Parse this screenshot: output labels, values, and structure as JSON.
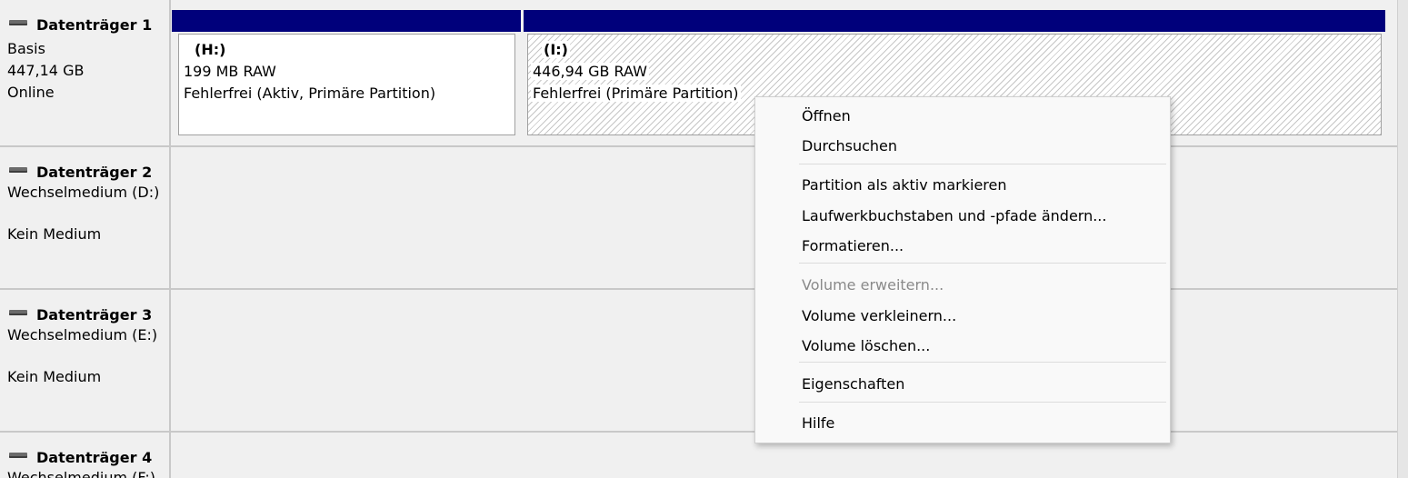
{
  "disks": [
    {
      "title": "Datenträger 1",
      "lines": [
        "Basis",
        "447,14 GB",
        "Online"
      ],
      "partitions": [
        {
          "title": "(H:)",
          "size": "199 MB RAW",
          "status": "Fehlerfrei (Aktiv, Primäre Partition)"
        },
        {
          "title": "(I:)",
          "size": "446,94 GB RAW",
          "status": "Fehlerfrei (Primäre Partition)"
        }
      ]
    },
    {
      "title": "Datenträger 2",
      "line1": "Wechselmedium (D:)",
      "line2": "Kein Medium"
    },
    {
      "title": "Datenträger 3",
      "line1": "Wechselmedium (E:)",
      "line2": "Kein Medium"
    },
    {
      "title": "Datenträger 4",
      "line1": "Wechselmedium (F:)"
    }
  ],
  "context_menu": {
    "open": "Öffnen",
    "explore": "Durchsuchen",
    "mark_active": "Partition als aktiv markieren",
    "change_letter": "Laufwerkbuchstaben und -pfade ändern...",
    "format": "Formatieren...",
    "extend": "Volume erweitern...",
    "shrink": "Volume verkleinern...",
    "delete": "Volume löschen...",
    "properties": "Eigenschaften",
    "help": "Hilfe"
  },
  "colors": {
    "partition_bar": "#00007b",
    "background": "#f0f0f0"
  }
}
